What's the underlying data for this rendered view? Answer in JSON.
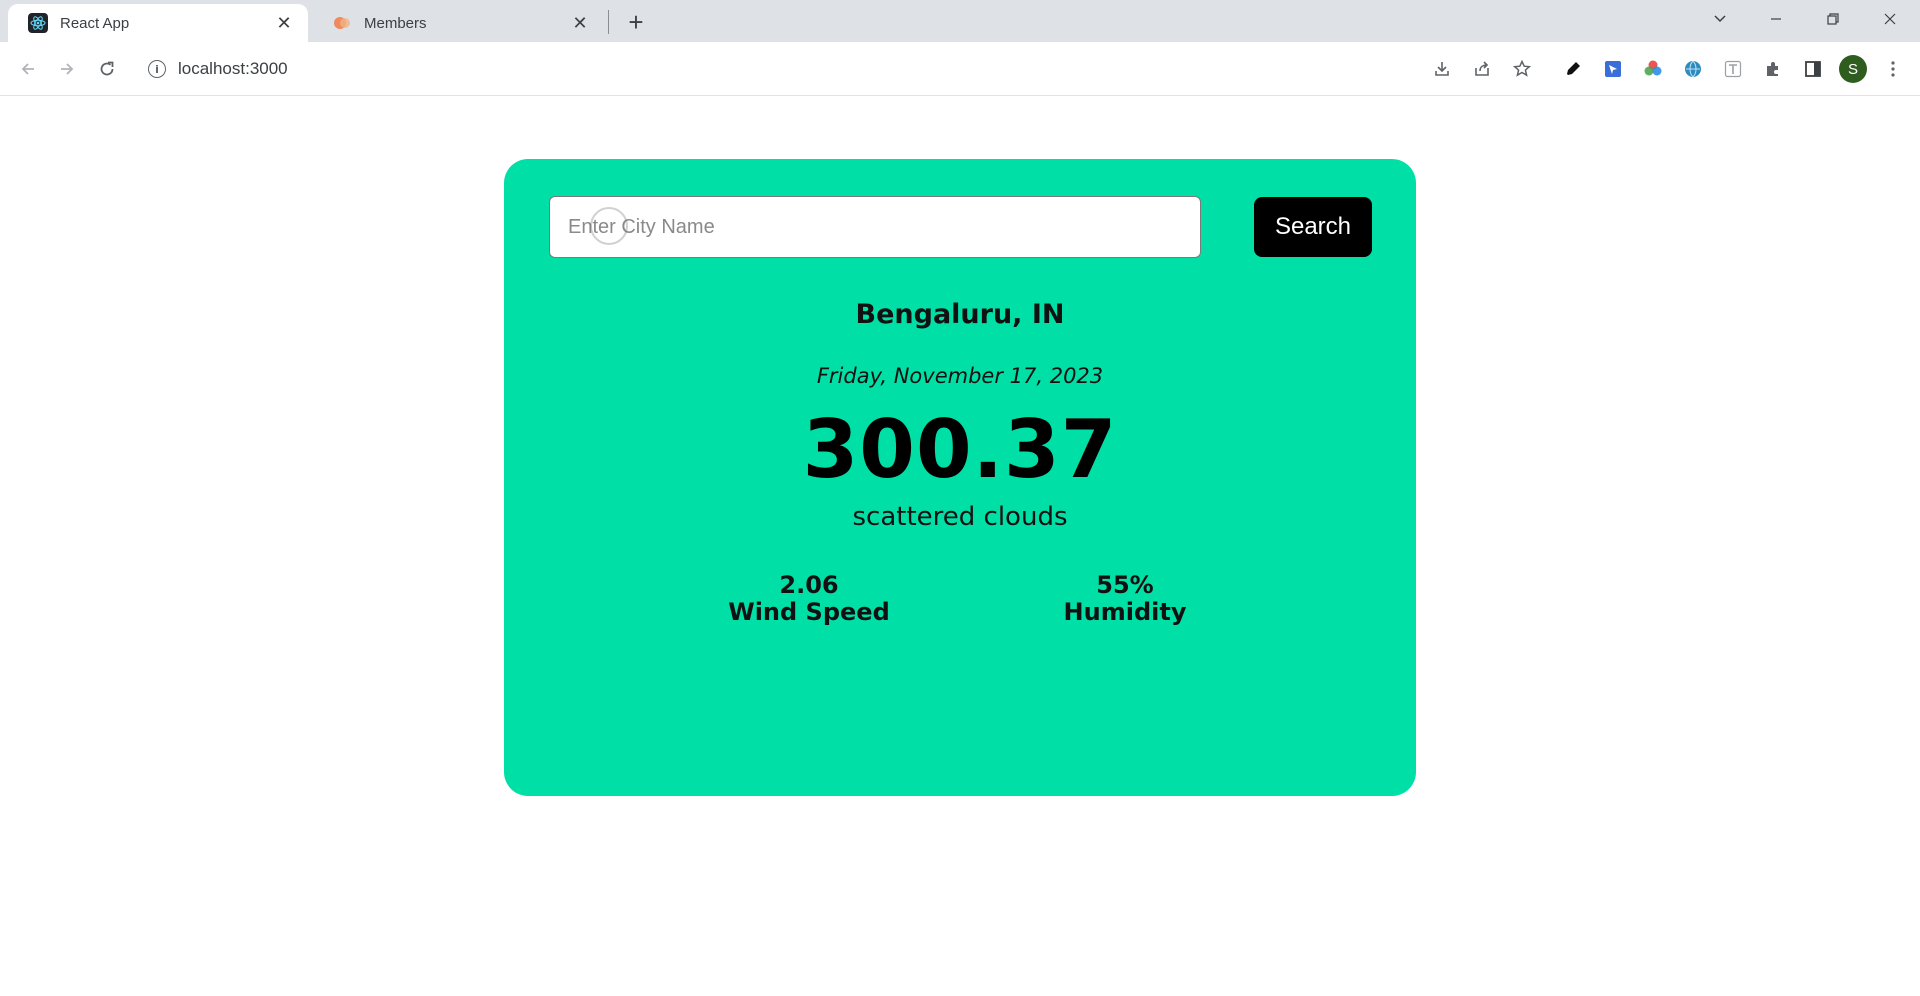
{
  "browser": {
    "tabs": [
      {
        "title": "React App",
        "active": true,
        "favicon": "react-icon"
      },
      {
        "title": "Members",
        "active": false,
        "favicon": "members-icon"
      }
    ],
    "url": "localhost:3000",
    "avatar_letter": "S",
    "avatar_color": "#2f5d1f"
  },
  "search": {
    "placeholder": "Enter City Name",
    "value": "",
    "button_label": "Search"
  },
  "weather": {
    "city": "Bengaluru, IN",
    "date": "Friday, November 17, 2023",
    "temperature": "300.37",
    "description": "scattered clouds",
    "wind_speed_value": "2.06",
    "wind_speed_label": "Wind Speed",
    "humidity_value": "55%",
    "humidity_label": "Humidity"
  },
  "colors": {
    "card_background": "#00dfa6",
    "search_button": "#000000"
  }
}
